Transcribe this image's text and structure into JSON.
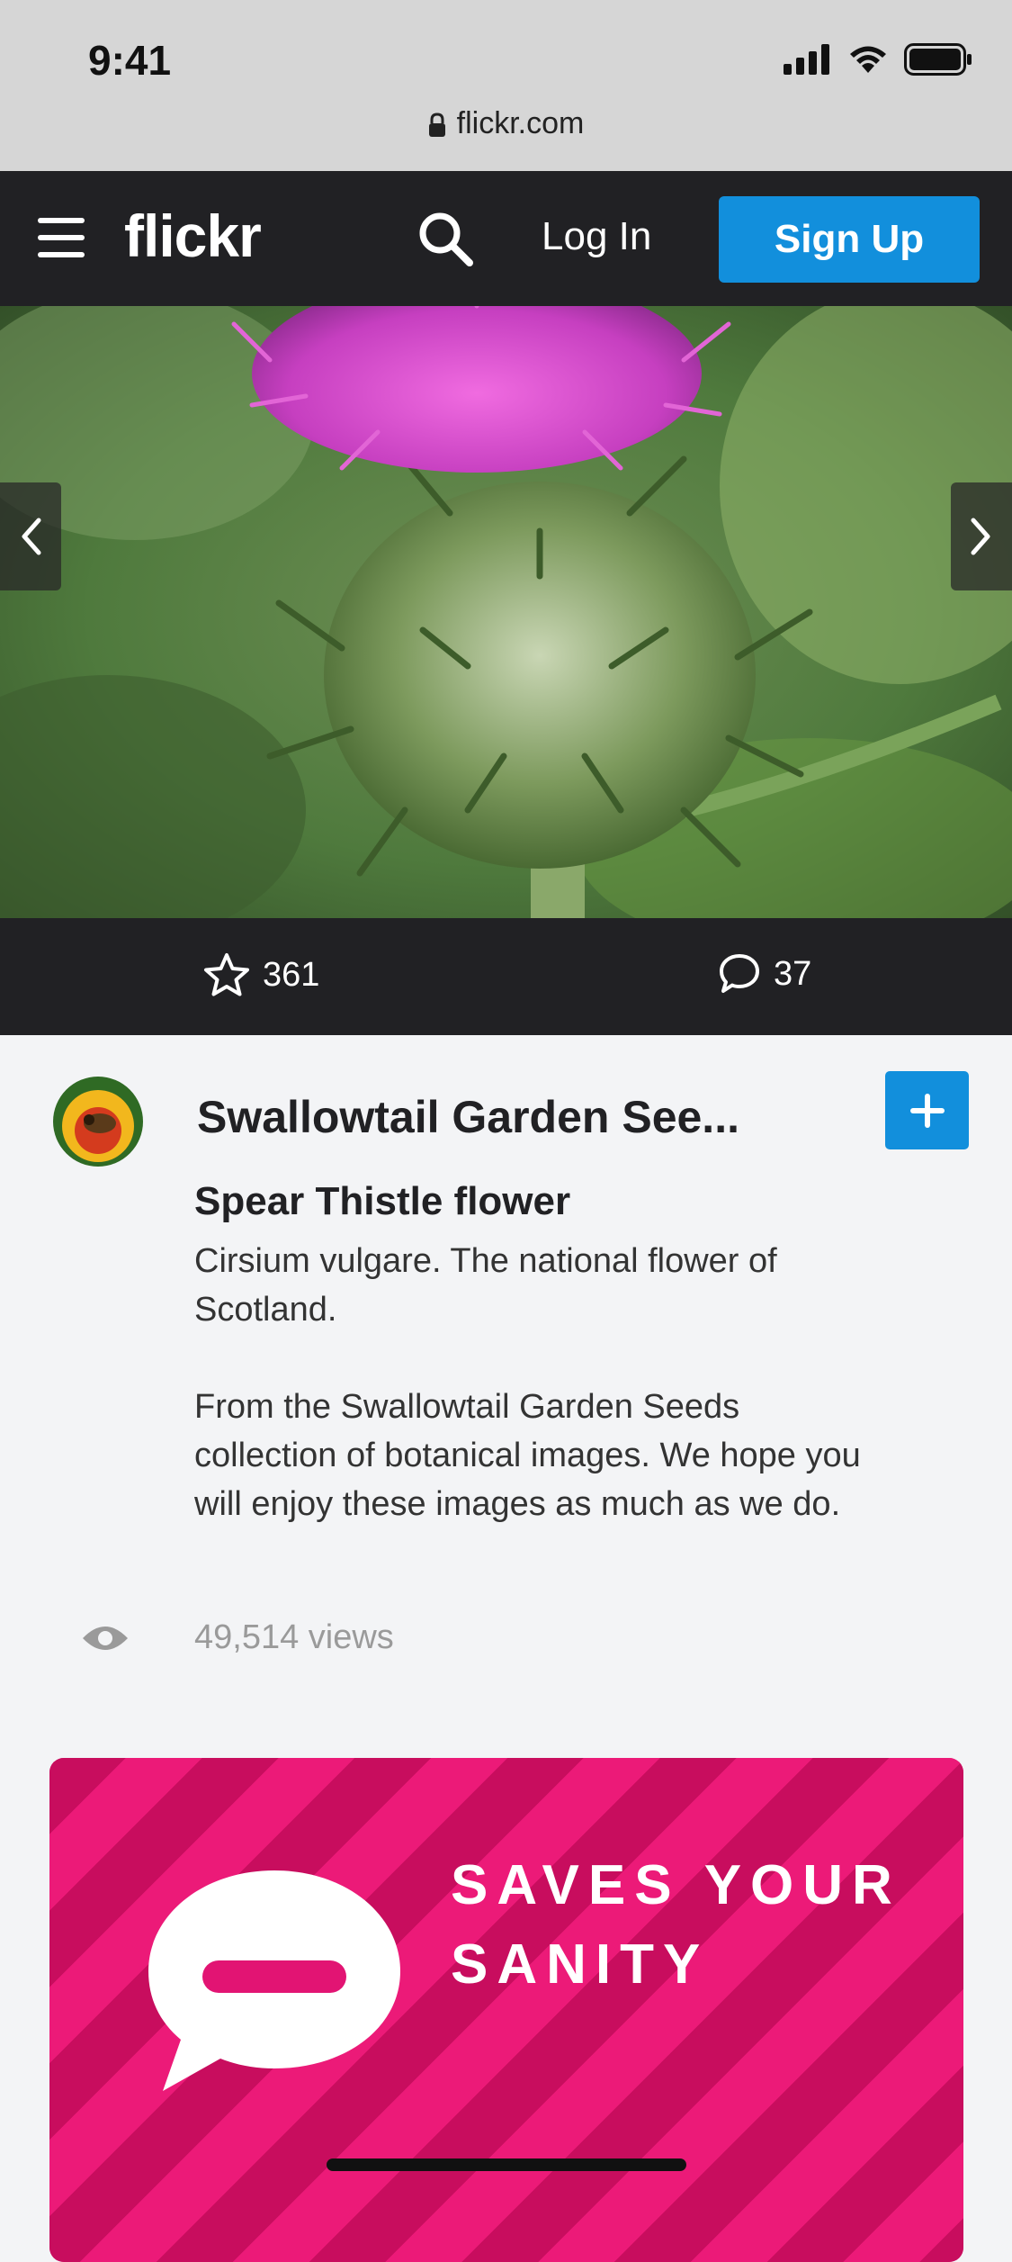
{
  "status_bar": {
    "time": "9:41",
    "url": "flickr.com",
    "icons": [
      "signal-icon",
      "wifi-icon",
      "battery-icon"
    ]
  },
  "nav": {
    "logo": "flickr",
    "login_label": "Log In",
    "signup_label": "Sign Up",
    "accent_color": "#128fdc"
  },
  "photo": {
    "prev_icon": "chevron-left-icon",
    "next_icon": "chevron-right-icon"
  },
  "stats": {
    "favorites": "361",
    "comments": "37"
  },
  "author": {
    "name": "Swallowtail Garden See..."
  },
  "photo_info": {
    "title": "Spear Thistle flower",
    "description_1": "Cirsium vulgare. The national flower of Scotland.",
    "description_2": "From the Swallowtail Garden Seeds collection of botanical images. We hope you will enjoy these images as much as we do.",
    "views": "49,514 views"
  },
  "ad": {
    "headline_1": "SAVES YOUR",
    "headline_2": "SANITY"
  }
}
